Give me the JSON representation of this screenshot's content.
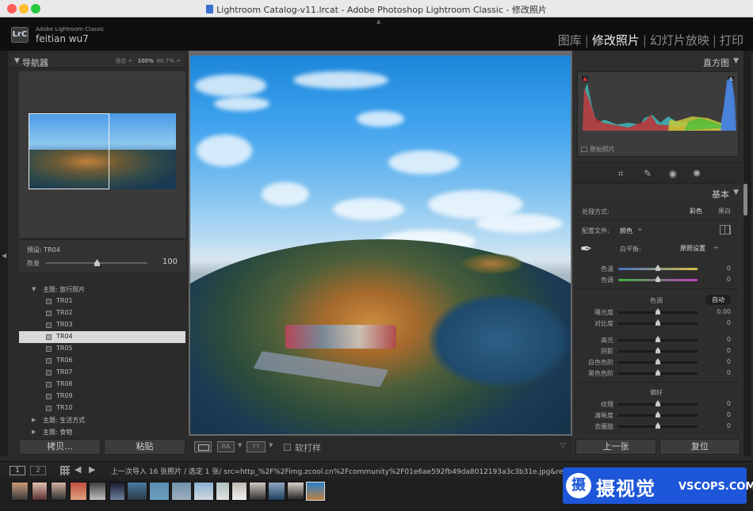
{
  "window": {
    "title": "Lightroom Catalog-v11.lrcat - Adobe Photoshop Lightroom Classic - 修改照片"
  },
  "identity": {
    "logo": "LrC",
    "app_name": "Adobe Lightroom Classic",
    "user": "feitian wu7"
  },
  "modules": [
    {
      "label": "图库",
      "active": false
    },
    {
      "label": "修改照片",
      "active": true
    },
    {
      "label": "幻灯片放映",
      "active": false
    },
    {
      "label": "打印",
      "active": false
    }
  ],
  "navigator": {
    "title": "导航器",
    "zoom_fit": "适合",
    "zoom_100": "100%",
    "zoom_custom": "66.7%"
  },
  "preset": {
    "label": "预设: TR04",
    "amount_label": "数量",
    "amount_value": "100",
    "amount_fraction": 0.5
  },
  "preset_list": [
    {
      "type": "folder",
      "label": "主题: 旅行照片",
      "expanded": true
    },
    {
      "type": "preset",
      "label": "TR01"
    },
    {
      "type": "preset",
      "label": "TR02"
    },
    {
      "type": "preset",
      "label": "TR03"
    },
    {
      "type": "preset",
      "label": "TR04",
      "selected": true
    },
    {
      "type": "preset",
      "label": "TR05"
    },
    {
      "type": "preset",
      "label": "TR06"
    },
    {
      "type": "preset",
      "label": "TR07"
    },
    {
      "type": "preset",
      "label": "TR08"
    },
    {
      "type": "preset",
      "label": "TR09"
    },
    {
      "type": "preset",
      "label": "TR10"
    },
    {
      "type": "folder",
      "label": "主题: 生活方式",
      "expanded": false
    },
    {
      "type": "folder",
      "label": "主题: 食物",
      "expanded": false
    }
  ],
  "left_buttons": {
    "copy": "拷贝...",
    "paste": "粘贴"
  },
  "toolbar": {
    "ra": "RA",
    "yy": "YY",
    "softproof": "软打样"
  },
  "histogram": {
    "title": "直方图",
    "original_label": "原始照片",
    "colors": {
      "red": "#c8292b",
      "green": "#3fbf3a",
      "blue": "#4a7ee0",
      "cyan": "#3fb7b7",
      "yellow": "#c8c93a"
    }
  },
  "basic": {
    "title": "基本",
    "treatment_label": "处理方式:",
    "treatment_color": "彩色",
    "treatment_bw": "黑白",
    "profile_label": "配置文件:",
    "profile_value": "颜色",
    "wb_label": "白平衡:",
    "wb_value": "原照设置",
    "temp_label": "色温",
    "temp_value": "0",
    "tint_label": "色调",
    "tint_value": "0",
    "tone_title": "色调",
    "auto_label": "自动",
    "exposure_label": "曝光度",
    "exposure_value": "0.00",
    "contrast_label": "对比度",
    "contrast_value": "0",
    "highlights_label": "高光",
    "highlights_value": "0",
    "shadows_label": "阴影",
    "shadows_value": "0",
    "whites_label": "白色色阶",
    "whites_value": "0",
    "blacks_label": "黑色色阶",
    "blacks_value": "0",
    "presence_title": "偏好",
    "texture_label": "纹理",
    "texture_value": "0",
    "clarity_label": "清晰度",
    "clarity_value": "0",
    "dehaze_label": "去朦胧",
    "dehaze_value": "0"
  },
  "right_buttons": {
    "previous": "上一张",
    "reset": "复位"
  },
  "filmstrip": {
    "page1": "1",
    "page2": "2",
    "info": "上一次导入  16 张照片 / 选定 1 张/ src=http_%2F%2Fimg.zcool.cn%2Fcommunity%2F01e6ae592fb49da8012193a3c3b31e.jpg&refer=http_%2F%"
  },
  "watermark": {
    "mark": "摄",
    "text": "摄视觉",
    "url": "VSCOPS.COM"
  }
}
